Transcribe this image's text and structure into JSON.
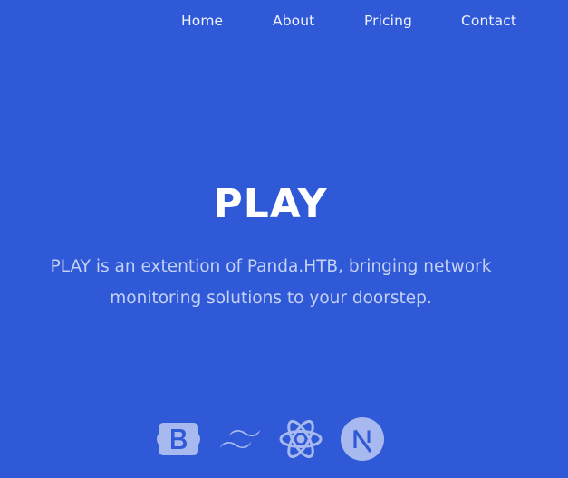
{
  "colors": {
    "background": "#2f59d6",
    "text": "#ffffff",
    "logo_fill": "#a7b9ef"
  },
  "nav": {
    "items": [
      {
        "label": "Home"
      },
      {
        "label": "About"
      },
      {
        "label": "Pricing"
      },
      {
        "label": "Contact"
      }
    ]
  },
  "hero": {
    "title": "PLAY",
    "subtitle": "PLAY is an extention of Panda.HTB, bringing network monitoring solutions to your doorstep."
  },
  "tech_logos": [
    {
      "icon": "bootstrap-icon"
    },
    {
      "icon": "tailwind-icon"
    },
    {
      "icon": "react-icon"
    },
    {
      "icon": "nextjs-icon"
    }
  ]
}
